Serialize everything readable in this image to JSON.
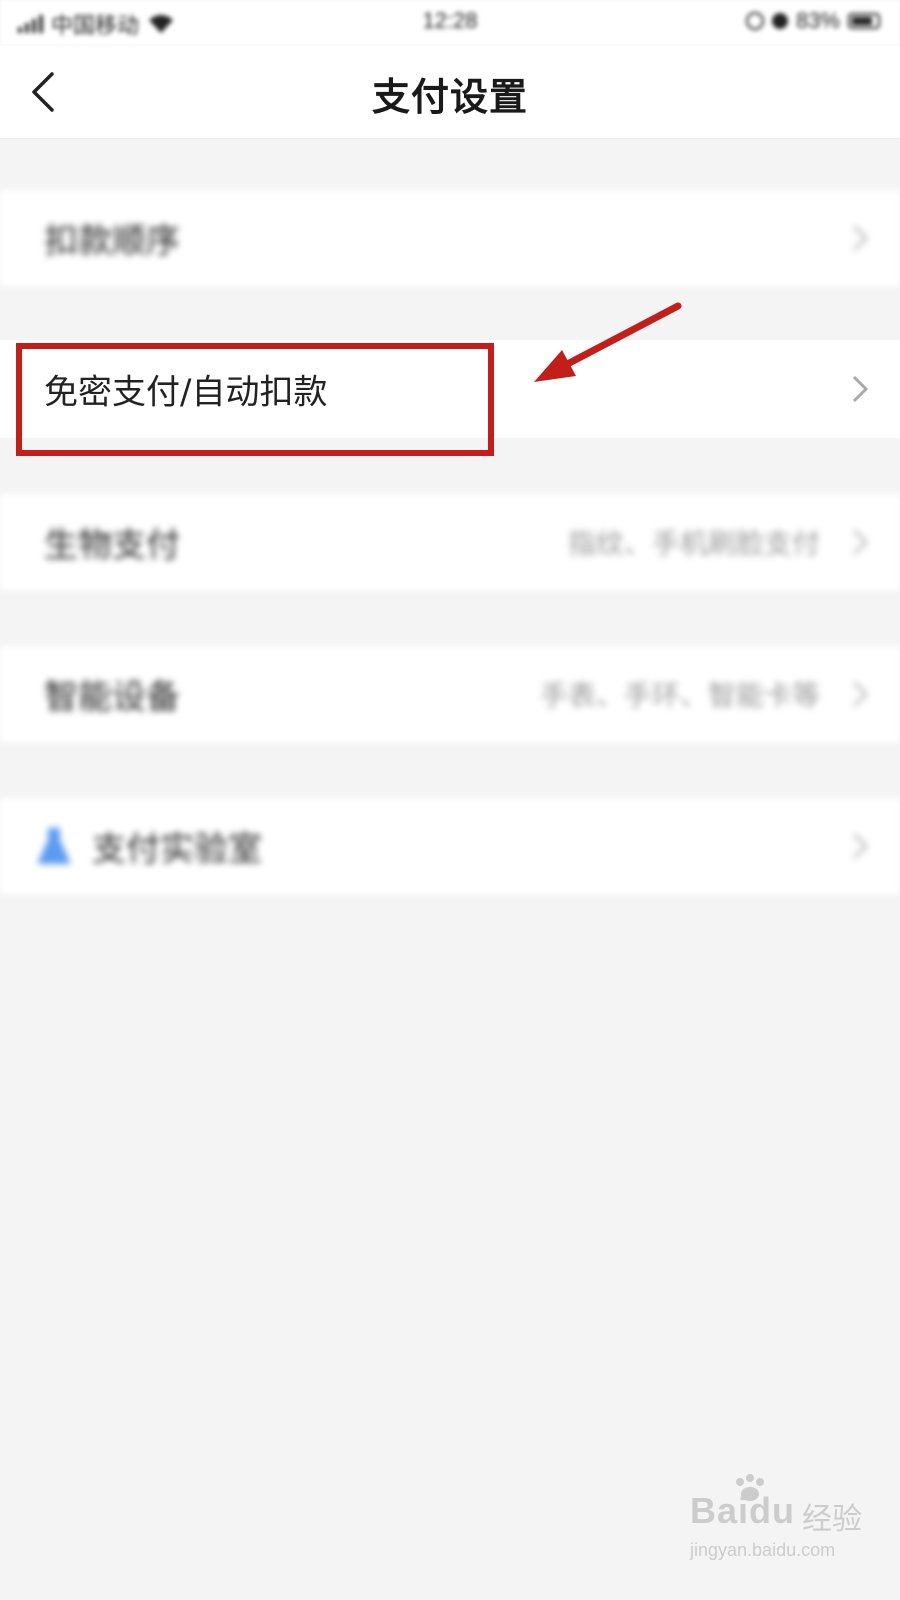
{
  "status_bar": {
    "carrier": "中国移动",
    "time": "12:28",
    "battery": "83%"
  },
  "nav": {
    "title": "支付设置"
  },
  "rows": [
    {
      "label": "扣款顺序",
      "hint": ""
    },
    {
      "label": "免密支付/自动扣款",
      "hint": ""
    },
    {
      "label": "生物支付",
      "hint": "指纹、手机刷脸支付"
    },
    {
      "label": "智能设备",
      "hint": "手表、手环、智能卡等"
    },
    {
      "label": "支付实验室",
      "hint": ""
    }
  ],
  "icons": [
    "back-icon",
    "chevron-right-icon",
    "lab-flask-icon",
    "wifi-icon",
    "signal-icon",
    "battery-icon"
  ],
  "colors": {
    "annotation_red": "#c41e1a",
    "page_bg": "#f4f4f4",
    "row_bg": "#ffffff",
    "lab_icon_blue": "#5b9bf0"
  },
  "watermark": {
    "brand": "Bai",
    "brand_tail": "du",
    "product": "经验",
    "url": "jingyan.baidu.com"
  }
}
